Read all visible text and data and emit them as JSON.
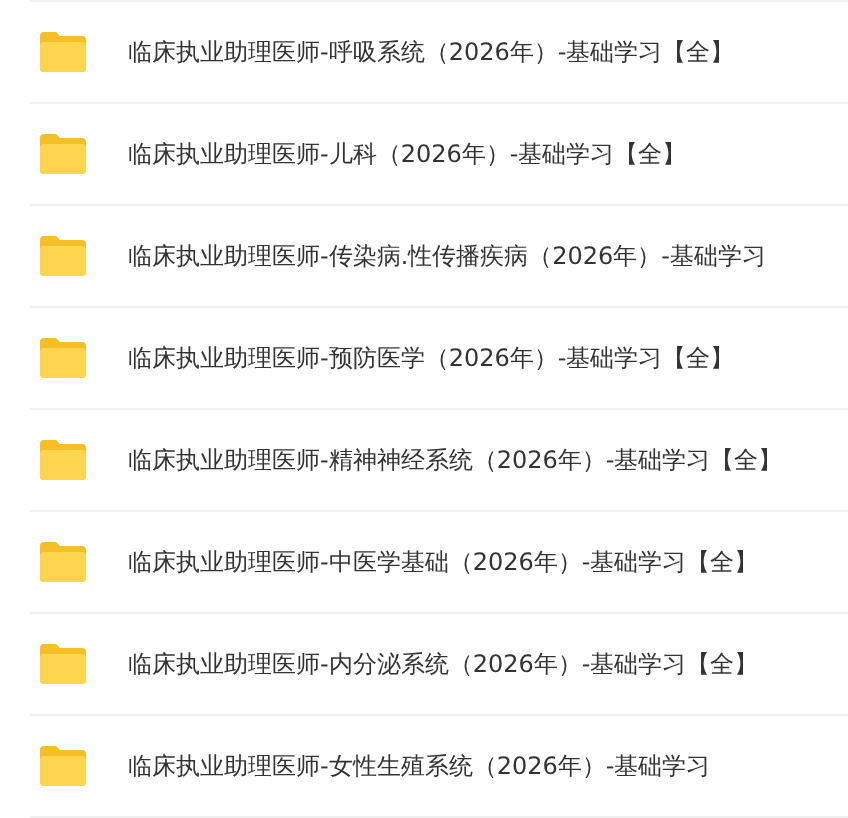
{
  "folders": [
    {
      "name": "临床执业助理医师-呼吸系统（2026年）-基础学习【全】"
    },
    {
      "name": "临床执业助理医师-儿科（2026年）-基础学习【全】"
    },
    {
      "name": "临床执业助理医师-传染病.性传播疾病（2026年）-基础学习"
    },
    {
      "name": "临床执业助理医师-预防医学（2026年）-基础学习【全】"
    },
    {
      "name": "临床执业助理医师-精神神经系统（2026年）-基础学习【全】"
    },
    {
      "name": "临床执业助理医师-中医学基础（2026年）-基础学习【全】"
    },
    {
      "name": "临床执业助理医师-内分泌系统（2026年）-基础学习【全】"
    },
    {
      "name": "临床执业助理医师-女性生殖系统（2026年）-基础学习"
    }
  ]
}
